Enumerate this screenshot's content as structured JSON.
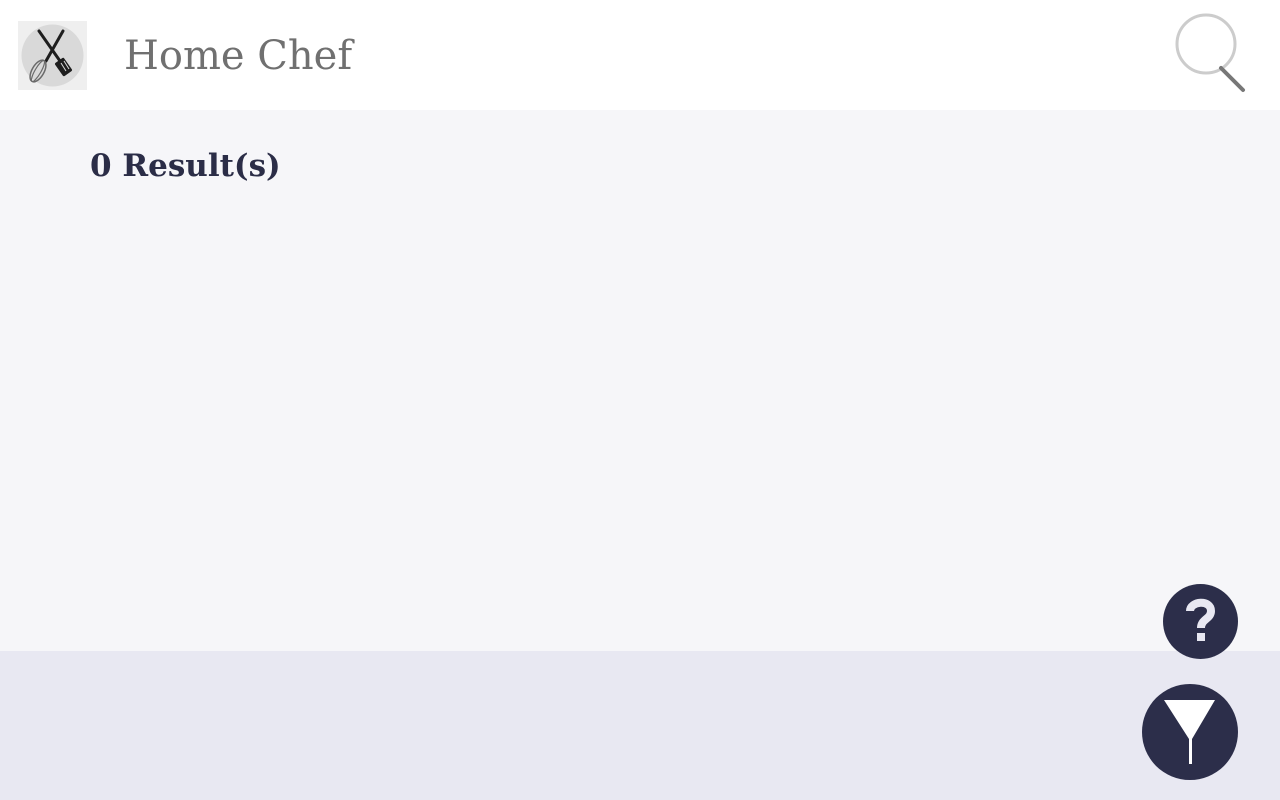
{
  "header": {
    "app_title": "Home Chef",
    "logo_icon": "whisk-spatula-icon",
    "search_icon": "search-icon"
  },
  "main": {
    "results_label": "0 Result(s)"
  },
  "fab": {
    "help_icon": "question-icon",
    "filter_icon": "funnel-icon"
  },
  "colors": {
    "header_bg": "#ffffff",
    "main_bg": "#f6f6f9",
    "footer_bg": "#e8e8f2",
    "accent_dark": "#2c2e4a",
    "title_gray": "#707070"
  }
}
